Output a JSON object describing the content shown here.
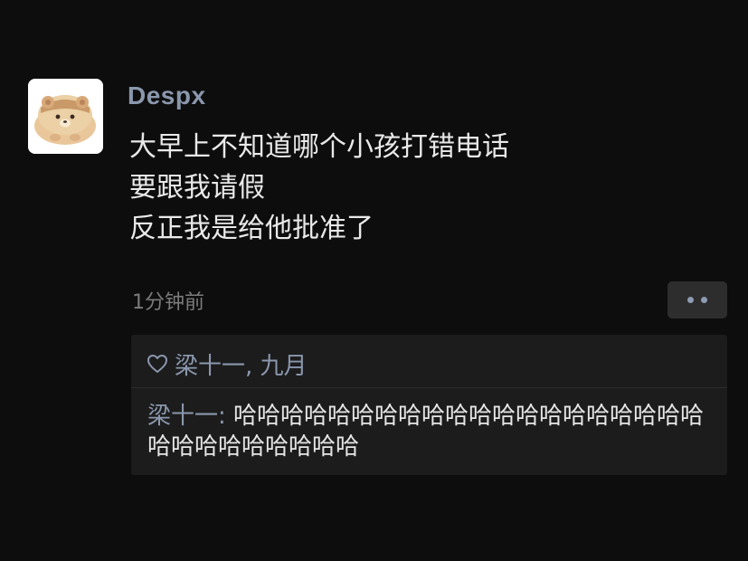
{
  "post": {
    "username": "Despx",
    "content_lines": [
      "大早上不知道哪个小孩打错电话",
      "要跟我请假",
      "反正我是给他批准了"
    ],
    "timestamp": "1分钟前",
    "more_icon": "ellipsis-icon"
  },
  "likes": {
    "icon": "heart-outline-icon",
    "names": "梁十一, 九月"
  },
  "comments": [
    {
      "author": "梁十一",
      "separator": ": ",
      "text": "哈哈哈哈哈哈哈哈哈哈哈哈哈哈哈哈哈哈哈哈哈哈哈哈哈哈哈哈哈"
    }
  ],
  "colors": {
    "background": "#0d0d0d",
    "name_blue": "#8a97ad",
    "panel": "#1c1c1c",
    "text": "#e9e9e9",
    "muted": "#7b7b7b"
  }
}
